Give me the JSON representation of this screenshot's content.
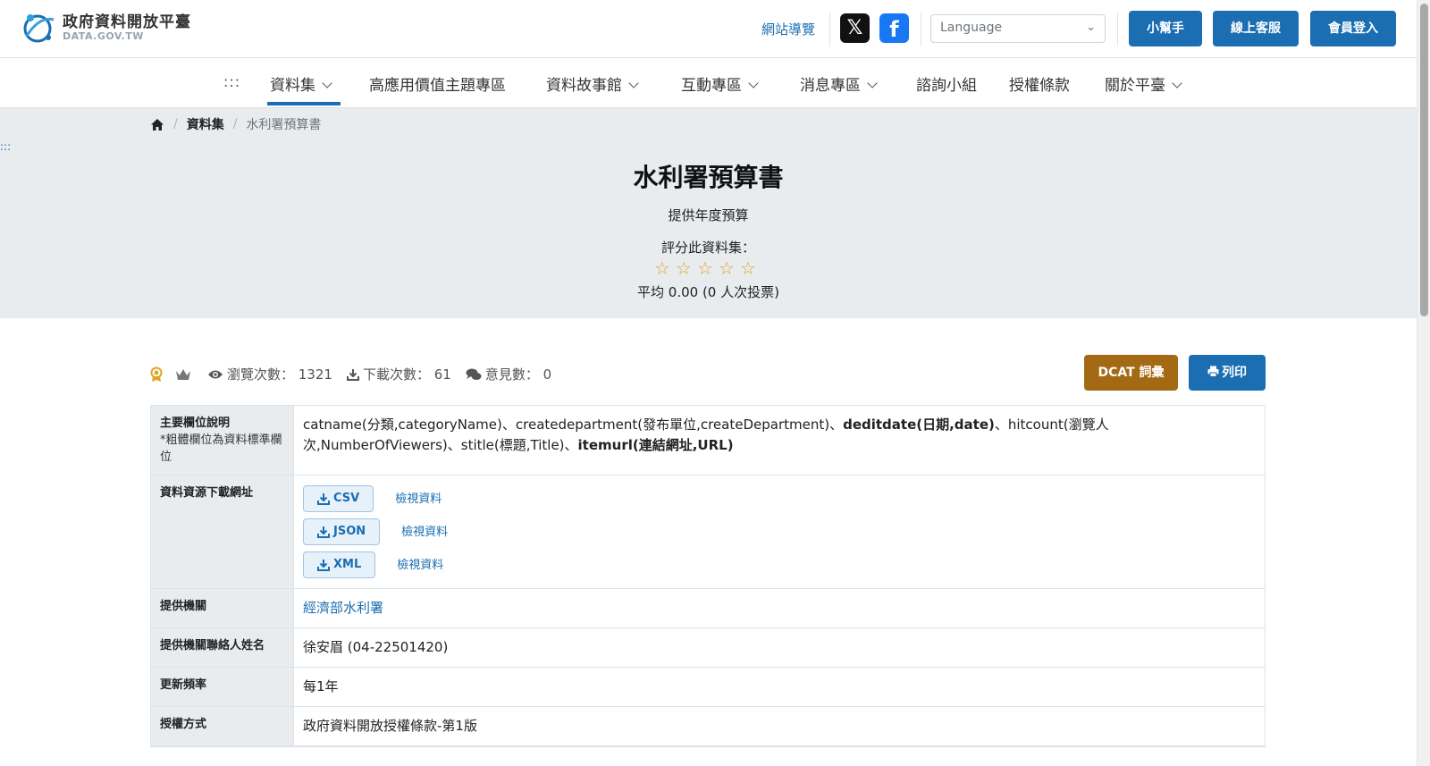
{
  "header": {
    "logo_cn": "政府資料開放平臺",
    "logo_en": "DATA.GOV.TW",
    "sitemap": "網站導覽",
    "x_icon": "x-logo-icon",
    "facebook_icon": "facebook-logo-icon",
    "language_placeholder": "Language",
    "helper": "小幫手",
    "support": "線上客服",
    "login": "會員登入"
  },
  "nav": {
    "accesskey": ":::",
    "items": [
      {
        "label": "資料集",
        "dropdown": true,
        "active": true
      },
      {
        "label": "高應用價值主題專區",
        "dropdown": false
      },
      {
        "label": "資料故事館",
        "dropdown": true
      },
      {
        "label": "互動專區",
        "dropdown": true
      },
      {
        "label": "消息專區",
        "dropdown": true
      },
      {
        "label": "諮詢小組",
        "dropdown": false
      },
      {
        "label": "授權條款",
        "dropdown": false
      },
      {
        "label": "關於平臺",
        "dropdown": true
      }
    ]
  },
  "breadcrumb": {
    "home_icon": "home-icon",
    "items": [
      "資料集",
      "水利署預算書"
    ]
  },
  "side_accesskey": ":::",
  "hero": {
    "title": "水利署預算書",
    "description": "提供年度預算",
    "rate_label": "評分此資料集：",
    "stars": 5,
    "average": "平均 0.00 (0 人次投票)"
  },
  "stats": {
    "views": "瀏覽次數： 1321",
    "downloads": "下載次數： 61",
    "comments": "意見數： 0",
    "dcat": "DCAT 詞彙",
    "print": "列印"
  },
  "table": {
    "fields_label": "主要欄位說明",
    "fields_note": "*粗體欄位為資料標準欄位",
    "fields_parts": {
      "p1": "catname(分類,categoryName)、createdepartment(發布單位,createDepartment)、",
      "b1": "deditdate(日期,date)",
      "p2": "、hitcount(瀏覽人次,NumberOfViewers)、stitle(標題,Title)、",
      "b2": "itemurl(連結網址,URL)"
    },
    "resources_label": "資料資源下載網址",
    "resources": [
      {
        "format": "CSV",
        "view": "檢視資料"
      },
      {
        "format": "JSON",
        "view": "檢視資料"
      },
      {
        "format": "XML",
        "view": "檢視資料"
      }
    ],
    "provider_label": "提供機關",
    "provider": "經濟部水利署",
    "contact_label": "提供機關聯絡人姓名",
    "contact": "徐安眉 (04-22501420)",
    "frequency_label": "更新頻率",
    "frequency": "每1年",
    "license_label": "授權方式",
    "license": "政府資料開放授權條款-第1版"
  }
}
